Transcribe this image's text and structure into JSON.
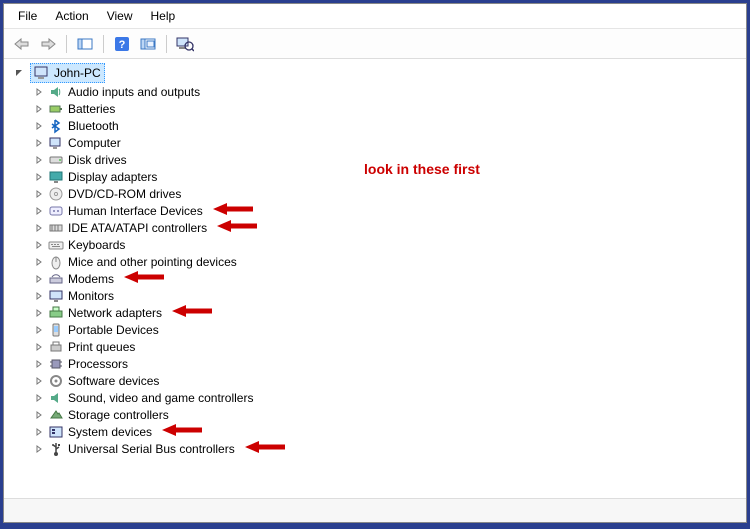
{
  "menubar": {
    "file": "File",
    "action": "Action",
    "view": "View",
    "help": "Help"
  },
  "root": {
    "label": "John-PC"
  },
  "categories": [
    {
      "label": "Audio inputs and outputs",
      "icon": "audio",
      "arrow": false
    },
    {
      "label": "Batteries",
      "icon": "battery",
      "arrow": false
    },
    {
      "label": "Bluetooth",
      "icon": "bluetooth",
      "arrow": false
    },
    {
      "label": "Computer",
      "icon": "computer",
      "arrow": false
    },
    {
      "label": "Disk drives",
      "icon": "disk",
      "arrow": false
    },
    {
      "label": "Display adapters",
      "icon": "display",
      "arrow": false
    },
    {
      "label": "DVD/CD-ROM drives",
      "icon": "dvd",
      "arrow": false
    },
    {
      "label": "Human Interface Devices",
      "icon": "hid",
      "arrow": true
    },
    {
      "label": "IDE ATA/ATAPI controllers",
      "icon": "ide",
      "arrow": true
    },
    {
      "label": "Keyboards",
      "icon": "keyboard",
      "arrow": false
    },
    {
      "label": "Mice and other pointing devices",
      "icon": "mouse",
      "arrow": false
    },
    {
      "label": "Modems",
      "icon": "modem",
      "arrow": true
    },
    {
      "label": "Monitors",
      "icon": "monitor",
      "arrow": false
    },
    {
      "label": "Network adapters",
      "icon": "network",
      "arrow": true
    },
    {
      "label": "Portable Devices",
      "icon": "portable",
      "arrow": false
    },
    {
      "label": "Print queues",
      "icon": "printer",
      "arrow": false
    },
    {
      "label": "Processors",
      "icon": "cpu",
      "arrow": false
    },
    {
      "label": "Software devices",
      "icon": "software",
      "arrow": false
    },
    {
      "label": "Sound, video and game controllers",
      "icon": "sound",
      "arrow": false
    },
    {
      "label": "Storage controllers",
      "icon": "storage",
      "arrow": false
    },
    {
      "label": "System devices",
      "icon": "system",
      "arrow": true
    },
    {
      "label": "Universal Serial Bus controllers",
      "icon": "usb",
      "arrow": true
    }
  ],
  "annotation": {
    "text": "look in these first",
    "color": "#c00000"
  }
}
